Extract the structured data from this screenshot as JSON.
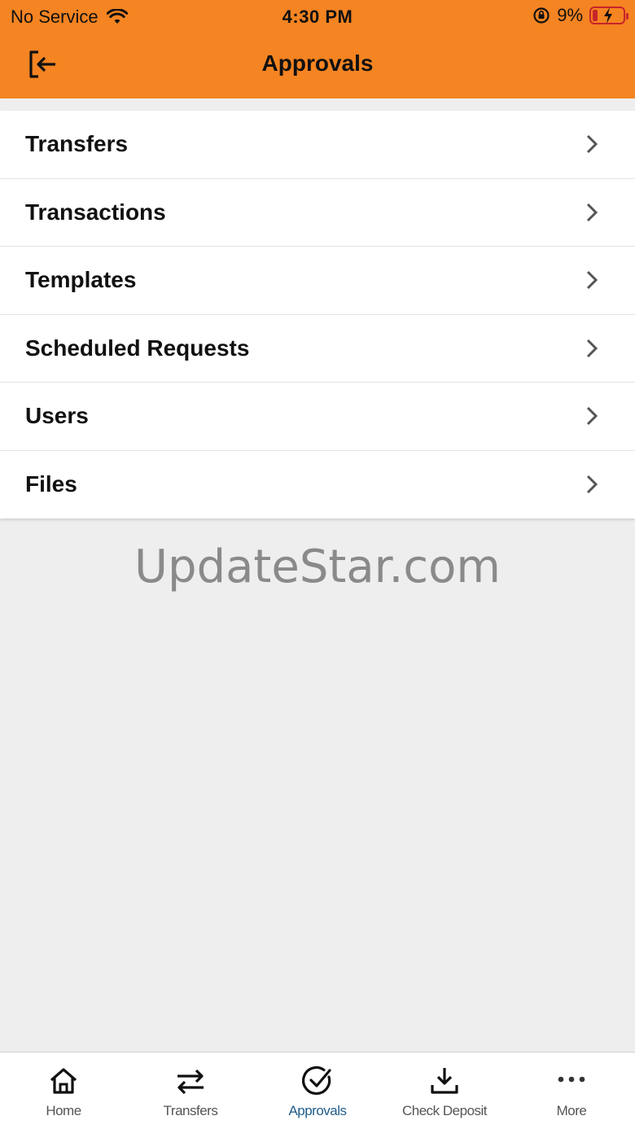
{
  "status_bar": {
    "carrier": "No Service",
    "time": "4:30 PM",
    "battery_percent": "9%",
    "battery_level": 0.09,
    "battery_color": "#c7242a"
  },
  "header": {
    "title": "Approvals",
    "background_color": "#f58422",
    "back_icon": "logout-arrow-icon"
  },
  "menu": {
    "items": [
      {
        "label": "Transfers",
        "icon": "chevron-right-icon"
      },
      {
        "label": "Transactions",
        "icon": "chevron-right-icon"
      },
      {
        "label": "Templates",
        "icon": "chevron-right-icon"
      },
      {
        "label": "Scheduled Requests",
        "icon": "chevron-right-icon"
      },
      {
        "label": "Users",
        "icon": "chevron-right-icon"
      },
      {
        "label": "Files",
        "icon": "chevron-right-icon"
      }
    ]
  },
  "watermark": "UpdateStar.com",
  "tabbar": {
    "active_color": "#1f5d8c",
    "tabs": [
      {
        "label": "Home",
        "icon": "home-icon"
      },
      {
        "label": "Transfers",
        "icon": "transfer-arrows-icon"
      },
      {
        "label": "Approvals",
        "icon": "check-circle-icon",
        "active": true
      },
      {
        "label": "Check Deposit",
        "icon": "download-tray-icon"
      },
      {
        "label": "More",
        "icon": "more-dots-icon"
      }
    ]
  }
}
